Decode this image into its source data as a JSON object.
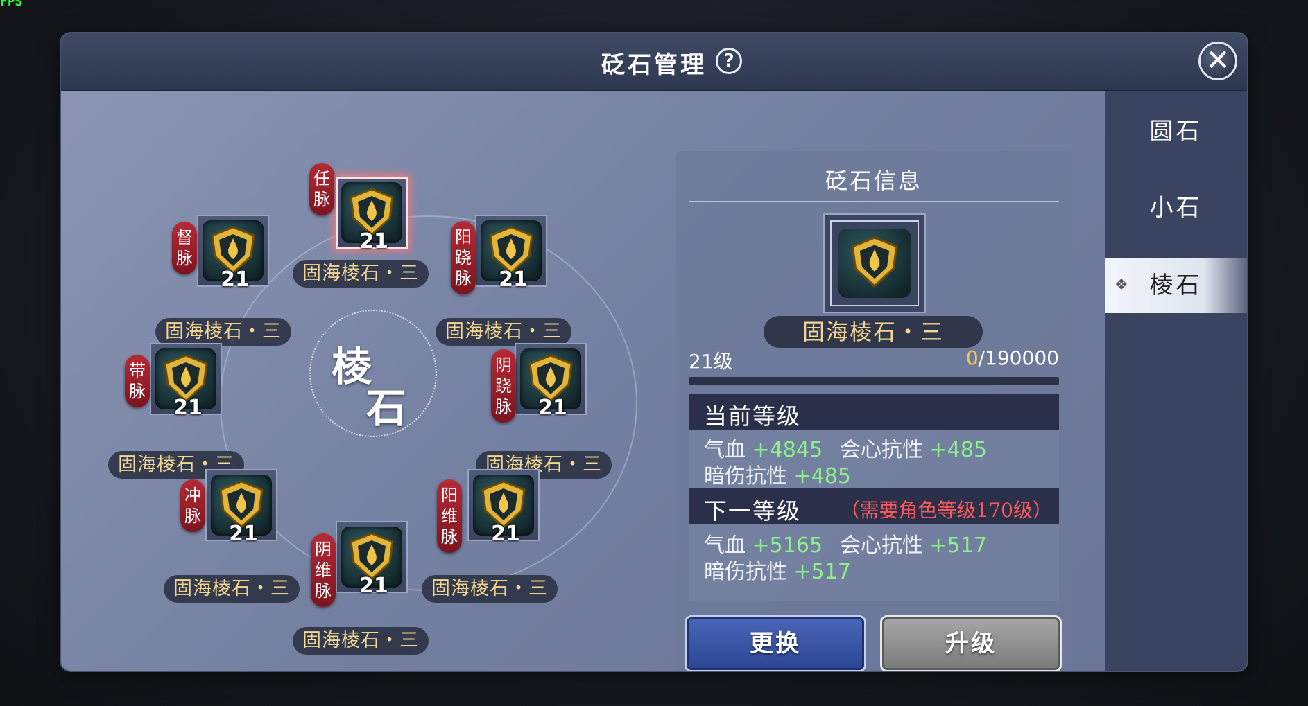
{
  "fps": "FPS",
  "title": "砭石管理",
  "help_label": "?",
  "close_label": "✕",
  "center_label": {
    "line1": "棱",
    "line2": "石"
  },
  "slots": [
    {
      "meridian": "任脉",
      "meridian_chars": [
        "任",
        "脉"
      ],
      "level": "21",
      "name": "固海棱石・三"
    },
    {
      "meridian": "督脉",
      "meridian_chars": [
        "督",
        "脉"
      ],
      "level": "21",
      "name": "固海棱石・三"
    },
    {
      "meridian": "阳跷脉",
      "meridian_chars": [
        "阳",
        "跷",
        "脉"
      ],
      "level": "21",
      "name": "固海棱石・三"
    },
    {
      "meridian": "带脉",
      "meridian_chars": [
        "带",
        "脉"
      ],
      "level": "21",
      "name": "固海棱石・三"
    },
    {
      "meridian": "阴跷脉",
      "meridian_chars": [
        "阴",
        "跷",
        "脉"
      ],
      "level": "21",
      "name": "固海棱石・三"
    },
    {
      "meridian": "冲脉",
      "meridian_chars": [
        "冲",
        "脉"
      ],
      "level": "21",
      "name": "固海棱石・三"
    },
    {
      "meridian": "阳维脉",
      "meridian_chars": [
        "阳",
        "维",
        "脉"
      ],
      "level": "21",
      "name": "固海棱石・三"
    },
    {
      "meridian": "阴维脉",
      "meridian_chars": [
        "阴",
        "维",
        "脉"
      ],
      "level": "21",
      "name": "固海棱石・三"
    }
  ],
  "info": {
    "title": "砭石信息",
    "stone_name": "固海棱石・三",
    "level_text": "21级",
    "exp_current": "0",
    "exp_total": "/190000",
    "exp_progress": 0,
    "current_header": "当前等级",
    "next_header": "下一等级",
    "next_requirement": "（需要角色等级170级）",
    "current_stats": [
      {
        "label": "气血",
        "value": "+4845"
      },
      {
        "label": "会心抗性",
        "value": "+485"
      },
      {
        "label": "暗伤抗性",
        "value": "+485"
      }
    ],
    "next_stats": [
      {
        "label": "气血",
        "value": "+5165"
      },
      {
        "label": "会心抗性",
        "value": "+517"
      },
      {
        "label": "暗伤抗性",
        "value": "+517"
      }
    ],
    "replace_label": "更换",
    "upgrade_label": "升级"
  },
  "tabs": [
    {
      "label": "圆石",
      "active": false
    },
    {
      "label": "小石",
      "active": false
    },
    {
      "label": "棱石",
      "active": true
    }
  ],
  "colors": {
    "name_gold": "#f3d690",
    "stat_green": "#8ef08a",
    "requirement_red": "#ff5a5a",
    "meridian_tag_red": "#9b1f2a"
  }
}
